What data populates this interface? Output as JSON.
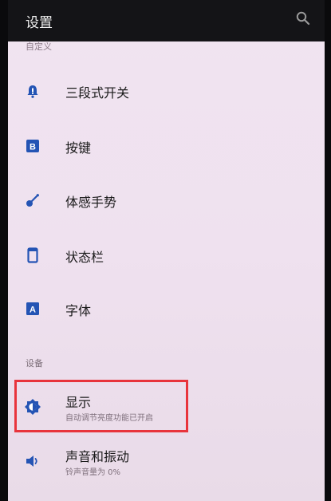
{
  "header": {
    "title": "设置",
    "search_icon": "search-icon"
  },
  "section_partial": "自定义",
  "items": [
    {
      "label": "三段式开关",
      "icon": "alert-slider-icon"
    },
    {
      "label": "按键",
      "icon": "b-key-icon"
    },
    {
      "label": "体感手势",
      "icon": "gesture-icon"
    },
    {
      "label": "状态栏",
      "icon": "status-bar-icon"
    },
    {
      "label": "字体",
      "icon": "font-a-icon"
    }
  ],
  "section": "设备",
  "device_items": [
    {
      "label": "显示",
      "subtitle": "自动调节亮度功能已开启",
      "icon": "display-brightness-icon"
    },
    {
      "label": "声音和振动",
      "subtitle": "铃声音量为 0%",
      "icon": "speaker-icon"
    }
  ],
  "colors": {
    "accent": "#2454b4",
    "highlight": "#e8343c",
    "header_bg": "#141417"
  }
}
